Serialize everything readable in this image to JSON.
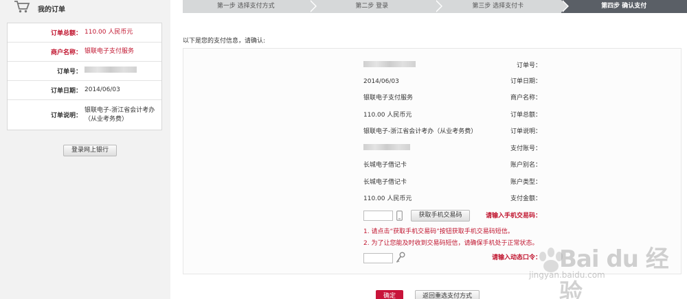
{
  "sidebar": {
    "title": "我的订单",
    "rows": [
      {
        "label": "订单总额：",
        "value": "110.00 人民币元"
      },
      {
        "label": "商户名称：",
        "value": "银联电子支付服务"
      },
      {
        "label": "订单号：",
        "value": ""
      },
      {
        "label": "订单日期：",
        "value": "2014/06/03"
      },
      {
        "label": "订单说明：",
        "value": "银联电子-浙江省会计考办（从业考务费）"
      }
    ],
    "login_button": "登录网上银行"
  },
  "steps": [
    {
      "label": "第一步  选择支付方式"
    },
    {
      "label": "第二步  登录"
    },
    {
      "label": "第三步  选择支付卡"
    },
    {
      "label": "第四步  确认支付"
    }
  ],
  "main": {
    "intro": "以下是您的支付信息，请确认:",
    "info": [
      {
        "label": "订单号：",
        "value": ""
      },
      {
        "label": "订单日期：",
        "value": "2014/06/03"
      },
      {
        "label": "商户名称：",
        "value": "银联电子支付服务"
      },
      {
        "label": "订单总额：",
        "value": "110.00 人民币元"
      },
      {
        "label": "订单说明：",
        "value": "银联电子-浙江省会计考办（从业考务费）"
      },
      {
        "label": "支付账号：",
        "value": ""
      },
      {
        "label": "账户别名：",
        "value": "长城电子借记卡"
      },
      {
        "label": "账户类型：",
        "value": "长城电子借记卡"
      },
      {
        "label": "支付金额：",
        "value": "110.00 人民币元"
      }
    ],
    "sms_label": "请输入手机交易码：",
    "sms_button": "获取手机交易码",
    "tip1": "1. 请点击“获取手机交易码”按钮获取手机交易码短信。",
    "tip2": "2. 为了让您能及时收到交易码短信，请确保手机处于正常状态。",
    "dynamic_label": "请输入动态口令："
  },
  "actions": {
    "confirm": "确定",
    "back": "返回重选支付方式"
  },
  "watermark": {
    "brand": "Bai du 经验",
    "url": "jingyan.baidu.com"
  },
  "colors": {
    "accent_red": "#c0142e",
    "step_active": "#5a5f66",
    "step_inactive": "#d6d8d9"
  }
}
